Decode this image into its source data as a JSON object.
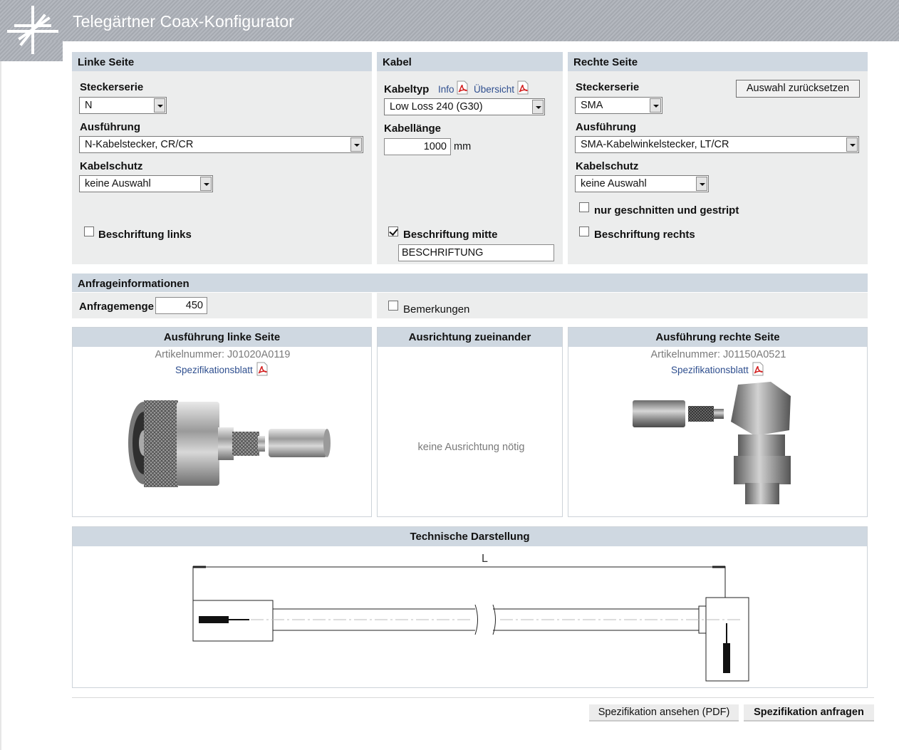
{
  "app": {
    "title": "Telegärtner Coax-Konfigurator"
  },
  "left": {
    "heading": "Linke Seite",
    "series_label": "Steckerserie",
    "series_value": "N",
    "type_label": "Ausführung",
    "type_value": "N-Kabelstecker, CR/CR",
    "protection_label": "Kabelschutz",
    "protection_value": "keine Auswahl",
    "marking_label": "Beschriftung links",
    "marking_checked": false
  },
  "cable": {
    "heading": "Kabel",
    "type_label": "Kabeltyp",
    "info_link": "Info",
    "overview_link": "Übersicht",
    "type_value": "Low Loss 240 (G30)",
    "length_label": "Kabellänge",
    "length_value": "1000",
    "length_unit": "mm",
    "marking_label": "Beschriftung mitte",
    "marking_checked": true,
    "marking_text": "BESCHRIFTUNG"
  },
  "right": {
    "heading": "Rechte Seite",
    "reset_button": "Auswahl zurücksetzen",
    "series_label": "Steckerserie",
    "series_value": "SMA",
    "type_label": "Ausführung",
    "type_value": "SMA-Kabelwinkelstecker, LT/CR",
    "protection_label": "Kabelschutz",
    "protection_value": "keine Auswahl",
    "cut_label": "nur geschnitten und gestript",
    "cut_checked": false,
    "marking_label": "Beschriftung rechts",
    "marking_checked": false
  },
  "request": {
    "heading": "Anfrageinformationen",
    "quantity_label": "Anfragemenge",
    "quantity_value": "450",
    "remarks_label": "Bemerkungen",
    "remarks_checked": false
  },
  "details": {
    "left": {
      "heading": "Ausführung linke Seite",
      "article": "Artikelnummer: J01020A0119",
      "spec_link": "Spezifikationsblatt",
      "product_image": "n-cable-connector-photo"
    },
    "middle": {
      "heading": "Ausrichtung zueinander",
      "note": "keine Ausrichtung nötig"
    },
    "right": {
      "heading": "Ausführung rechte Seite",
      "article": "Artikelnummer: J01150A0521",
      "spec_link": "Spezifikationsblatt",
      "product_image": "sma-right-angle-connector-photo"
    }
  },
  "drawing": {
    "heading": "Technische Darstellung",
    "length_symbol": "L"
  },
  "actions": {
    "view_pdf": "Spezifikation ansehen (PDF)",
    "request": "Spezifikation anfragen"
  },
  "colors": {
    "header_bg": "#a9adb4",
    "panel_bg": "#eceded",
    "panel_head": "#cfd8e1",
    "link": "#2f4f8f",
    "pdf_red": "#d32020"
  }
}
